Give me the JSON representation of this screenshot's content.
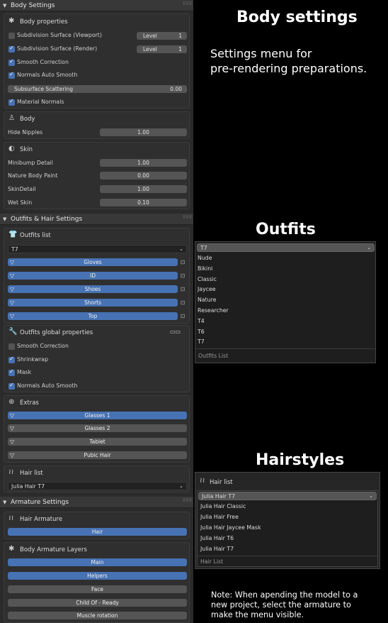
{
  "body_panel": {
    "title": "Body Settings",
    "props_title": "Body properties",
    "subdiv_viewport": {
      "label": "Subdivision Surface (Viewport)",
      "field_label": "Level",
      "value": "1"
    },
    "subdiv_render": {
      "label": "Subdivision Surface (Render)",
      "field_label": "Level",
      "value": "1"
    },
    "smooth_correction": "Smooth Correction",
    "normals_auto_smooth": "Normals Auto Smooth",
    "subsurface": {
      "label": "Subsurface Scattering",
      "value": "0.00"
    },
    "material_normals": "Material Normals",
    "body_title": "Body",
    "hide_nipples": {
      "label": "Hide Nipples",
      "value": "1.00"
    },
    "skin_title": "Skin",
    "skin_rows": [
      {
        "label": "Minibump Detail",
        "value": "1.00"
      },
      {
        "label": "Nature Body Paint",
        "value": "0.00"
      },
      {
        "label": "SkinDetail",
        "value": "1.00"
      },
      {
        "label": "Wet Skin",
        "value": "0.10"
      }
    ]
  },
  "outfits_panel": {
    "title": "Outfits & Hair Settings",
    "list_title": "Outfits list",
    "selected": "T7",
    "items": [
      "Gloves",
      "ID",
      "Shoes",
      "Shorts",
      "Top"
    ],
    "global_title": "Outfits global properties",
    "smooth_correction": "Smooth Correction",
    "shrinkwrap": "Shrinkwrap",
    "mask": "Mask",
    "normals_auto_smooth": "Normals Auto Smooth",
    "extras_title": "Extras",
    "extras": [
      "Glasses 1",
      "Glasses 2",
      "Tablet",
      "Pubic Hair"
    ],
    "hair_title": "Hair list",
    "hair_selected": "Julia Hair T7"
  },
  "armature_panel": {
    "title": "Armature Settings",
    "hair_arm_title": "Hair Armature",
    "hair_button": "Hair",
    "layers_title": "Body Armature Layers",
    "layers": [
      "Main",
      "Helpers",
      "Face",
      "Child Of - Ready",
      "Muscle rotation"
    ]
  },
  "annotations": {
    "body_heading": "Body settings",
    "body_desc_line1": "Settings menu for",
    "body_desc_line2": "pre-rendering preparations.",
    "outfits_heading": "Outfits",
    "hair_heading": "Hairstyles",
    "note_line1": "Note: When apending the model to a",
    "note_line2": "new project, select the armature to",
    "note_line3": "make the menu visible."
  },
  "outfits_popup": {
    "selected": "T7",
    "options": [
      "Nude",
      "Bikini",
      "Classic",
      "Jaycee",
      "Nature",
      "Researcher",
      "T4",
      "T6",
      "T7"
    ],
    "footer": "Outfits List"
  },
  "hair_popup": {
    "header": "Hair list",
    "selected": "Julia Hair T7",
    "options": [
      "Julia Hair Classic",
      "Julia Hair Free",
      "Julia Hair Jaycee Mask",
      "Julia Hair T6",
      "Julia Hair T7"
    ],
    "footer": "Hair List"
  },
  "colors": {
    "accent": "#4772b3",
    "panel": "#2b2b2b",
    "background": "#000000"
  }
}
